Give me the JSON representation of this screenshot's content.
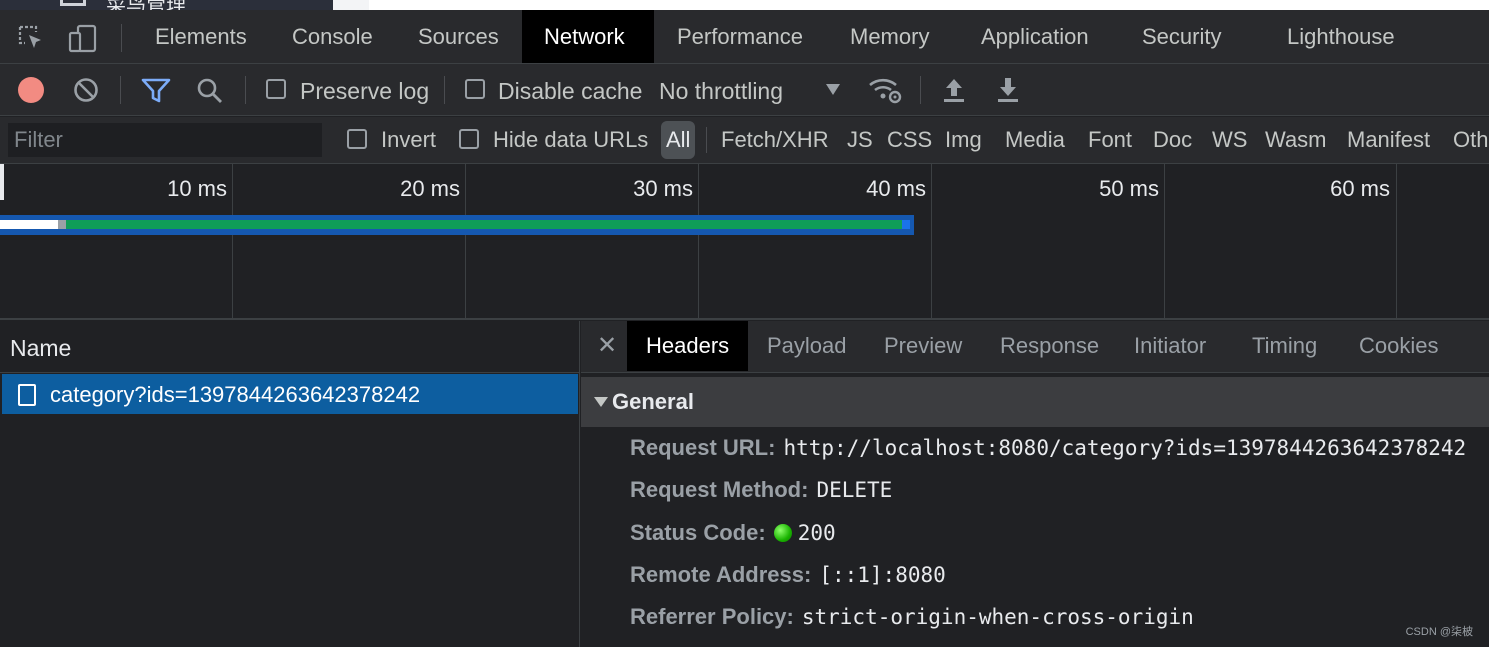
{
  "page_strip": {
    "text": "菜鸟管理"
  },
  "main_tabs": [
    {
      "label": "Elements"
    },
    {
      "label": "Console"
    },
    {
      "label": "Sources"
    },
    {
      "label": "Network",
      "active": true
    },
    {
      "label": "Performance"
    },
    {
      "label": "Memory"
    },
    {
      "label": "Application"
    },
    {
      "label": "Security"
    },
    {
      "label": "Lighthouse"
    }
  ],
  "toolbar": {
    "preserve_log": "Preserve log",
    "disable_cache": "Disable cache",
    "throttling": "No throttling",
    "record_color": "#f28b82",
    "filter_active_color": "#7cacf8"
  },
  "filterbar": {
    "placeholder": "Filter",
    "invert": "Invert",
    "hide_data_urls": "Hide data URLs",
    "types": [
      "All",
      "Fetch/XHR",
      "JS",
      "CSS",
      "Img",
      "Media",
      "Font",
      "Doc",
      "WS",
      "Wasm",
      "Manifest",
      "Oth"
    ]
  },
  "timeline": {
    "ticks": [
      "10 ms",
      "20 ms",
      "30 ms",
      "40 ms",
      "50 ms",
      "60 ms"
    ],
    "bar_colors": {
      "waiting": "#ffffff",
      "stalled": "#9aa0a6",
      "ttfb": "#0f9d58",
      "download": "#1a73e8"
    }
  },
  "name_panel": {
    "header": "Name",
    "requests": [
      {
        "name": "category?ids=1397844263642378242"
      }
    ]
  },
  "detail": {
    "tabs": [
      {
        "label": "Headers",
        "active": true
      },
      {
        "label": "Payload"
      },
      {
        "label": "Preview"
      },
      {
        "label": "Response"
      },
      {
        "label": "Initiator"
      },
      {
        "label": "Timing"
      },
      {
        "label": "Cookies"
      }
    ],
    "general_title": "General",
    "general": {
      "request_url_key": "Request URL:",
      "request_url": "http://localhost:8080/category?ids=1397844263642378242",
      "request_method_key": "Request Method:",
      "request_method": "DELETE",
      "status_code_key": "Status Code:",
      "status_code": "200",
      "remote_address_key": "Remote Address:",
      "remote_address": "[::1]:8080",
      "referrer_policy_key": "Referrer Policy:",
      "referrer_policy": "strict-origin-when-cross-origin"
    }
  },
  "watermark": "CSDN @柒柀"
}
